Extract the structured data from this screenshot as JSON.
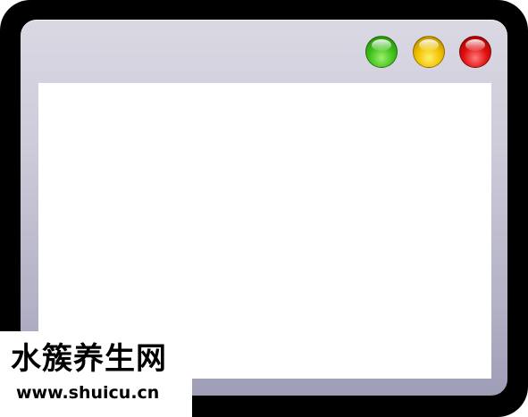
{
  "window": {
    "controls": [
      {
        "name": "green",
        "color": "#41c21b"
      },
      {
        "name": "yellow",
        "color": "#f2c200"
      },
      {
        "name": "red",
        "color": "#e01010"
      }
    ],
    "frame_color": "#cccbd9",
    "content_background": "#ffffff"
  },
  "watermark": {
    "title": "水簇养生网",
    "url": "www.shuicu.cn"
  }
}
